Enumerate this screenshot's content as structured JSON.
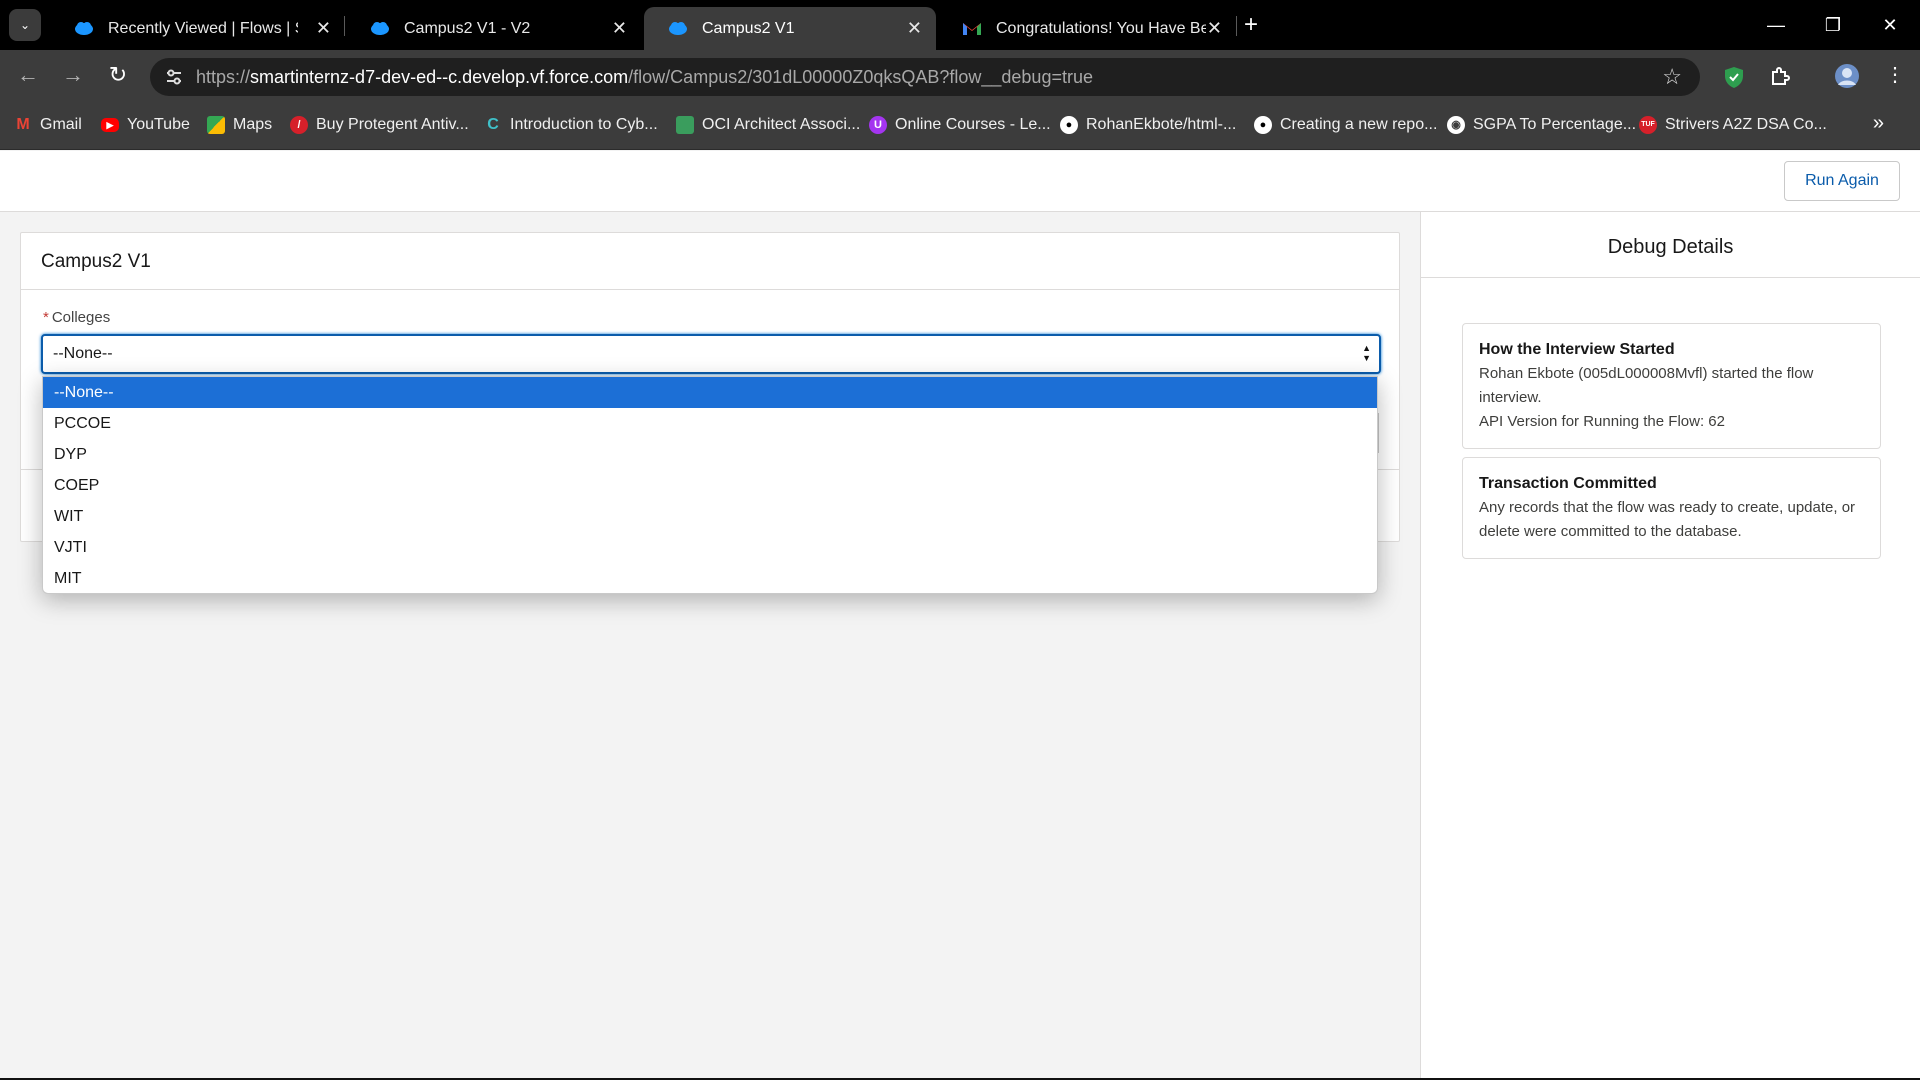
{
  "browser": {
    "tabs": [
      {
        "title": "Recently Viewed | Flows | Salesf",
        "favicon": "salesforce-cloud-icon",
        "active": false
      },
      {
        "title": "Campus2 V1 - V2",
        "favicon": "salesforce-cloud-icon",
        "active": false
      },
      {
        "title": "Campus2 V1",
        "favicon": "salesforce-cloud-icon",
        "active": true
      },
      {
        "title": "Congratulations! You Have Been",
        "favicon": "gmail-icon",
        "active": false
      }
    ],
    "url_scheme": "https://",
    "url_host": "smartinternz-d7-dev-ed--c.develop.vf.force.com",
    "url_path": "/flow/Campus2/301dL00000Z0qksQAB?flow__debug=true",
    "bookmarks": [
      {
        "label": "Gmail",
        "icon": "gmail-icon"
      },
      {
        "label": "YouTube",
        "icon": "youtube-icon"
      },
      {
        "label": "Maps",
        "icon": "maps-icon"
      },
      {
        "label": "Buy Protegent Antiv...",
        "icon": "protegent-icon"
      },
      {
        "label": "Introduction to Cyb...",
        "icon": "course-icon"
      },
      {
        "label": "OCI Architect Associ...",
        "icon": "oci-icon"
      },
      {
        "label": "Online Courses - Le...",
        "icon": "udemy-icon"
      },
      {
        "label": "RohanEkbote/html-...",
        "icon": "github-icon"
      },
      {
        "label": "Creating a new repo...",
        "icon": "github-icon"
      },
      {
        "label": "SGPA To Percentage...",
        "icon": "globe-icon"
      },
      {
        "label": "Strivers A2Z DSA Co...",
        "icon": "tuf-icon"
      }
    ]
  },
  "page": {
    "run_again_label": "Run Again",
    "card_title": "Campus2 V1",
    "field_label": "Colleges",
    "required_marker": "*",
    "selected_value": "--None--",
    "options": [
      "--None--",
      "PCCOE",
      "DYP",
      "COEP",
      "WIT",
      "VJTI",
      "MIT"
    ]
  },
  "debug": {
    "title": "Debug Details",
    "sections": [
      {
        "heading": "How the Interview Started",
        "lines": [
          "Rohan Ekbote (005dL000008Mvfl) started the flow interview.",
          "API Version for Running the Flow: 62"
        ]
      },
      {
        "heading": "Transaction Committed",
        "lines": [
          "Any records that the flow was ready to create, update, or delete were committed to the database."
        ]
      }
    ]
  },
  "colors": {
    "accent": "#0b5cab",
    "selected_option": "#1c6fd6",
    "required": "#c23934"
  }
}
